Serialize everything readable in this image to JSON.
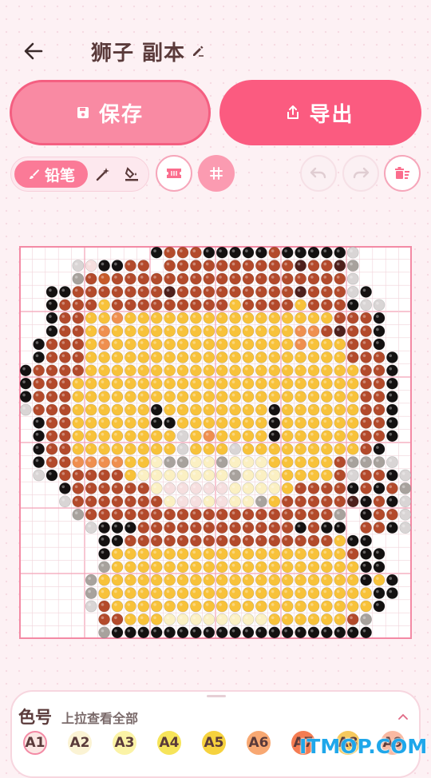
{
  "header": {
    "title": "狮子 副本"
  },
  "actions": {
    "save_label": "保存",
    "export_label": "导出"
  },
  "tools": {
    "pencil_label": "铅笔"
  },
  "colors": {
    "accent": "#fb5b80",
    "accent_light": "#f98aa3",
    "black": "#141111",
    "dark_brown": "#4e201c",
    "brown": "#8b3324",
    "rust": "#b34a2b",
    "orange_brown": "#c75b2a",
    "orange": "#ef8f4f",
    "peach": "#f4a978",
    "gold": "#f8c23a",
    "yellow": "#f9d251",
    "cream": "#fbf0c3",
    "pale_pink": "#f6dfdf",
    "grey": "#a8a29d",
    "light_grey": "#d9d5d5",
    "olive": "#3f4a23",
    "dark_olive": "#2d3418"
  },
  "board": {
    "grid_size": 30,
    "rows": [
      "..........KRRRKKKKKRKKKKKL....",
      "....LPKKRR.RRRRRRRRRRNRRNG....",
      "....GRMRRRRRRRRRRRRRRRRRRL....",
      "..KKRRRRRRRNRRRRRRRRRNRRRLK...",
      "..KRRRYRRRRRRRRRYRRRRYRRRKLL..",
      "..KRRYYOYYYYYYYYYYYYYYYYRRRK..",
      "..KRRYOYYYYYYYYYYYYYYOORNRRK..",
      ".KRRRYOYYYYYYYYYYYYYYOYYYRRK..",
      ".KRRRYYYYYYYYYYYYYYYYYYYYRRRK.",
      "KRRRRYYYYYYYYYYYYYYYYYYYYYRRK.",
      "KRRRYYYYYYYYYYYYYYYYYYYYYYRRK.",
      "KRRRYYYYYYYYYYYYYYYYYYYYYYRRK.",
      "LRRRYYYYYYKYYYYYYYYKYYYYYYRRK.",
      ".KRRYYYYYYKKYYYYYYYKYYYYYYRRK.",
      ".KRRYYYYYYYYLYOYYYYKYYYYYYRRK.",
      ".KRRYYYYYYYYLYYYLYYYYYYYYYRK..",
      ".KRROOOOYYCGGCCGCCCYYYYYRGGGL.",
      ".LKRRRRRYCCCCCCCGCCCYYYYRLRRKL",
      "...KRRRRRRCPPPPPCCCCYRRRRKRKRG",
      "...LRRRRRRRCPPCPCCGYRRRRRNKRKL",
      "....GRRRRRRRRRRRRRRRRRRRG.KRRL",
      ".....LKKKRRRRRRRRRRRRKRKK.RRKL",
      "......KKRRRRRRRRRRRRRRRRYKK...",
      "......KYYYYYYYYYYYYYYYYYYRKK..",
      "......GYYYYYYYYYYYYYYYYYYYKK..",
      ".....GYYYYYYYYYYYYYYYYYYYYKYK.",
      ".....GYYYYYYYYYYYYYYYYYYYYYKK.",
      ".....LRYYYYYYYYYYYYYYYYYYYYK..",
      "......RRYYYCCCCCCCCYYYYYYRG...",
      "......GKKKKKKKKKKKKKKKKKKKK..."
    ]
  },
  "palette": {
    "title": "色号",
    "hint": "上拉查看全部",
    "swatches": [
      {
        "label": "A1",
        "color": "#fbe7e4"
      },
      {
        "label": "A2",
        "color": "#fbf3d4"
      },
      {
        "label": "A3",
        "color": "#fbf3a6"
      },
      {
        "label": "A4",
        "color": "#f6e45a"
      },
      {
        "label": "A5",
        "color": "#f6d23e"
      },
      {
        "label": "A6",
        "color": "#f8a872"
      },
      {
        "label": "A7",
        "color": "#f47c52"
      },
      {
        "label": "A8",
        "color": "#f6c95d"
      },
      {
        "label": "A9",
        "color": "#f9b9a2"
      }
    ]
  },
  "watermark": "ITMOP.COM"
}
